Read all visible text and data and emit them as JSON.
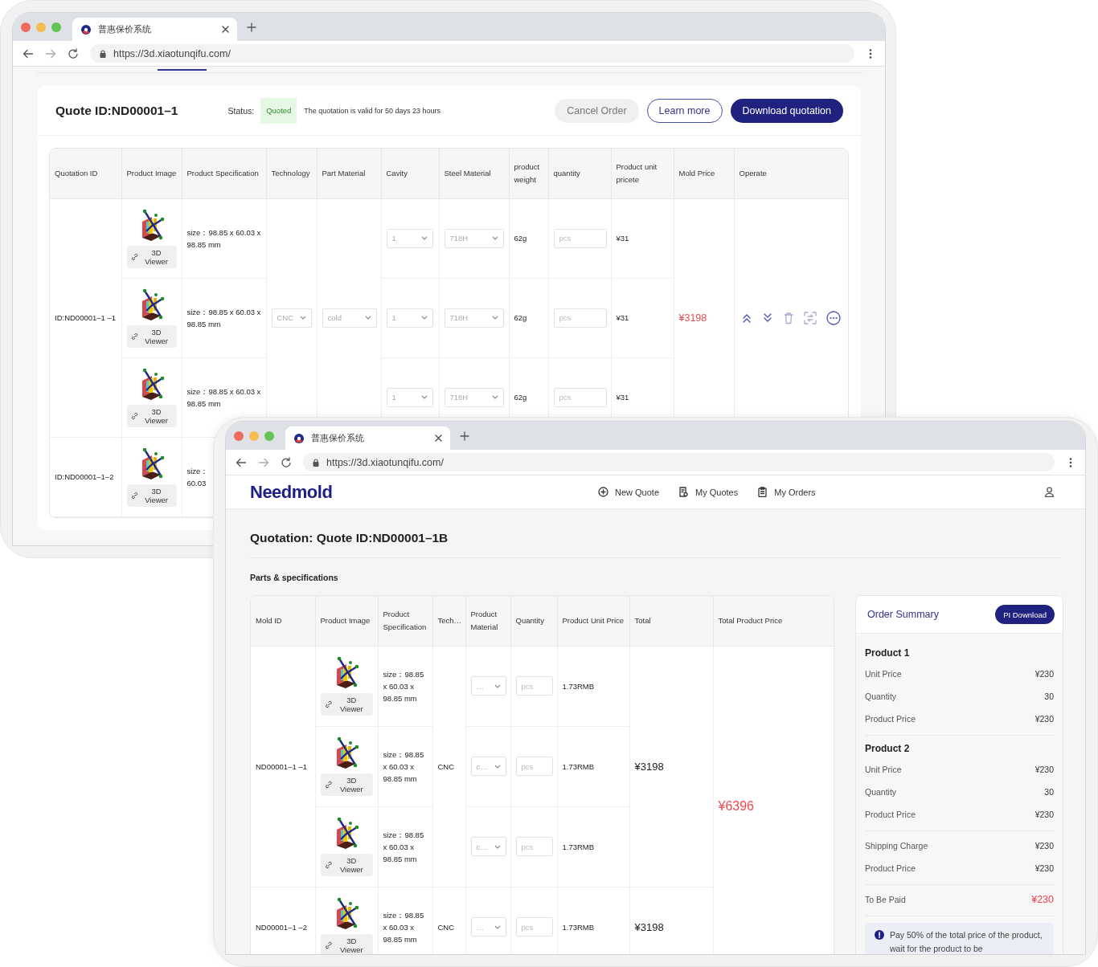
{
  "back_window": {
    "tab_title": "普惠保价系统",
    "url": "https://3d.xiaotunqifu.com/",
    "quote_id": "Quote ID:ND00001–1",
    "status_label": "Status:",
    "status": "Quoted",
    "validity": "The quotation is valid for 50 days 23 hours",
    "buttons": [
      {
        "label": "Cancel Order",
        "kind": "secondary"
      },
      {
        "label": "Learn more",
        "kind": "outline"
      },
      {
        "label": "Download quotation",
        "kind": "primary"
      }
    ],
    "table": {
      "columns": [
        "Quotation ID",
        "Product Image",
        "Product Specification",
        "Technology",
        "Part Material",
        "Cavity",
        "Steel Material",
        "product weight",
        "quantity",
        "Product unit pricete",
        "Mold Price",
        "Operate"
      ],
      "rows": [
        {
          "quotation_id": "ID:ND00001–1 –1",
          "technology": "CNC",
          "part_material": "cold",
          "mold_price": "¥3198",
          "parts": [
            {
              "viewer": "3D Viewer",
              "spec": "size：98.85 x 60.03 x 98.85 mm",
              "cavity": "1",
              "steel_material": "718H",
              "weight": "62g",
              "quantity_placeholder": "pcs",
              "unit_price": "¥31"
            },
            {
              "viewer": "3D Viewer",
              "spec": "size：98.85 x 60.03 x 98.85 mm",
              "cavity": "1",
              "steel_material": "718H",
              "weight": "62g",
              "quantity_placeholder": "pcs",
              "unit_price": "¥31"
            },
            {
              "viewer": "3D Viewer",
              "spec": "size：98.85 x 60.03 x 98.85 mm",
              "cavity": "1",
              "steel_material": "718H",
              "weight": "62g",
              "quantity_placeholder": "pcs",
              "unit_price": "¥31"
            }
          ]
        },
        {
          "quotation_id": "ID:ND00001–1–2",
          "parts": [
            {
              "viewer": "3D Viewer",
              "spec": "size：\n60.03"
            }
          ]
        }
      ]
    }
  },
  "front_window": {
    "tab_title": "普惠保价系统",
    "url": "https://3d.xiaotunqifu.com/",
    "logo": "Needmold",
    "nav": [
      {
        "label": "New Quote"
      },
      {
        "label": "My Quotes"
      },
      {
        "label": "My Orders"
      }
    ],
    "title": "Quotation: Quote ID:ND00001–1B",
    "section": "Parts & specifications",
    "table": {
      "columns": [
        "Mold ID",
        "Product Image",
        "Product Specification",
        "Tech…",
        "Product Material",
        "Quantity",
        "Product Unit Price",
        "Total",
        "Total Product Price"
      ],
      "total_product_price": "¥6396",
      "rows": [
        {
          "mold_id": "ND00001–1 –1",
          "technology": "CNC",
          "total": "¥3198",
          "parts": [
            {
              "viewer": "3D Viewer",
              "spec": "size：98.85 x 60.03 x 98.85 mm",
              "material": "…",
              "quantity_placeholder": "pcs",
              "unit_price": "1.73RMB"
            },
            {
              "viewer": "3D Viewer",
              "spec": "size：98.85 x 60.03 x 98.85 mm",
              "material": "c…",
              "quantity_placeholder": "pcs",
              "unit_price": "1.73RMB"
            },
            {
              "viewer": "3D Viewer",
              "spec": "size：98.85 x 60.03 x 98.85 mm",
              "material": "c…",
              "quantity_placeholder": "pcs",
              "unit_price": "1.73RMB"
            }
          ]
        },
        {
          "mold_id": "ND00001–1 –2",
          "technology": "CNC",
          "total": "¥3198",
          "parts": [
            {
              "viewer": "3D Viewer",
              "spec": "size：98.85 x 60.03 x 98.85 mm",
              "material": "…",
              "quantity_placeholder": "pcs",
              "unit_price": "1.73RMB"
            }
          ]
        }
      ]
    },
    "summary": {
      "title": "Order Summary",
      "button": "PI Download",
      "groups": [
        {
          "heading": "Product 1",
          "lines": [
            {
              "label": "Unit Price",
              "value": "¥230",
              "kind": "normal"
            },
            {
              "label": "Quantity",
              "value": "30",
              "kind": "normal"
            },
            {
              "label": "Product Price",
              "value": "¥230",
              "kind": "normal"
            }
          ]
        },
        {
          "heading": "Product 2",
          "lines": [
            {
              "label": "Unit Price",
              "value": "¥230",
              "kind": "normal"
            },
            {
              "label": "Quantity",
              "value": "30",
              "kind": "normal"
            },
            {
              "label": "Product Price",
              "value": "¥230",
              "kind": "normal"
            }
          ]
        },
        {
          "lines": [
            {
              "label": "Shipping Charge",
              "value": "¥230",
              "kind": "normal"
            },
            {
              "label": "Product Price",
              "value": "¥230",
              "kind": "normal"
            }
          ]
        },
        {
          "lines": [
            {
              "label": "To Be Paid",
              "value": "¥230",
              "kind": "total"
            }
          ]
        }
      ],
      "notice": "Pay 50% of the total price of the product, wait for the product to be"
    }
  }
}
